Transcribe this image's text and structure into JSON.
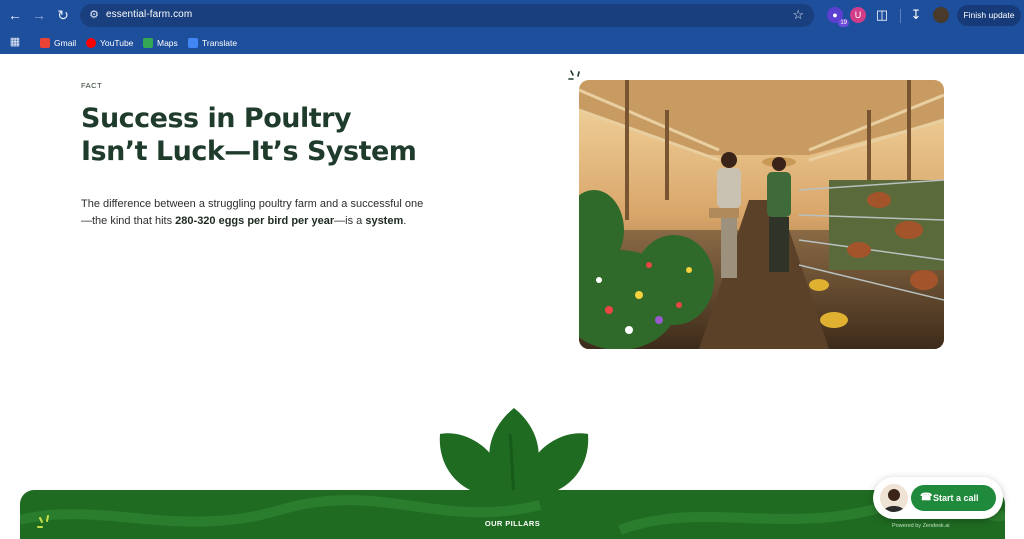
{
  "browser": {
    "url": "essential-farm.com",
    "finish_update_label": "Finish update",
    "extension_badge": "19",
    "bookmarks": [
      {
        "label": "Gmail",
        "icon": "gmail-icon",
        "color": "#ea4335"
      },
      {
        "label": "YouTube",
        "icon": "youtube-icon",
        "color": "#ff0000"
      },
      {
        "label": "Maps",
        "icon": "maps-icon",
        "color": "#34a853"
      },
      {
        "label": "Translate",
        "icon": "translate-icon",
        "color": "#4285f4"
      }
    ]
  },
  "page": {
    "eyebrow": "FACT",
    "headline": "Success in Poultry Isn’t Luck—It’s System",
    "paragraph": {
      "part1": "The difference between a struggling poultry farm and a successful one—the kind that hits ",
      "bold1": "280-320 eggs per bird per year",
      "part2": "—is a ",
      "bold2": "system",
      "part3": "."
    },
    "section_label": "OUR PILLARS",
    "call_label": "Start a call",
    "powered_text": "Powered by Zendesk.ai"
  },
  "colors": {
    "browser_chrome": "#1e4f9c",
    "headline": "#1f3b2b",
    "brand_green": "#1f6b22",
    "call_green": "#1f8a3b"
  }
}
